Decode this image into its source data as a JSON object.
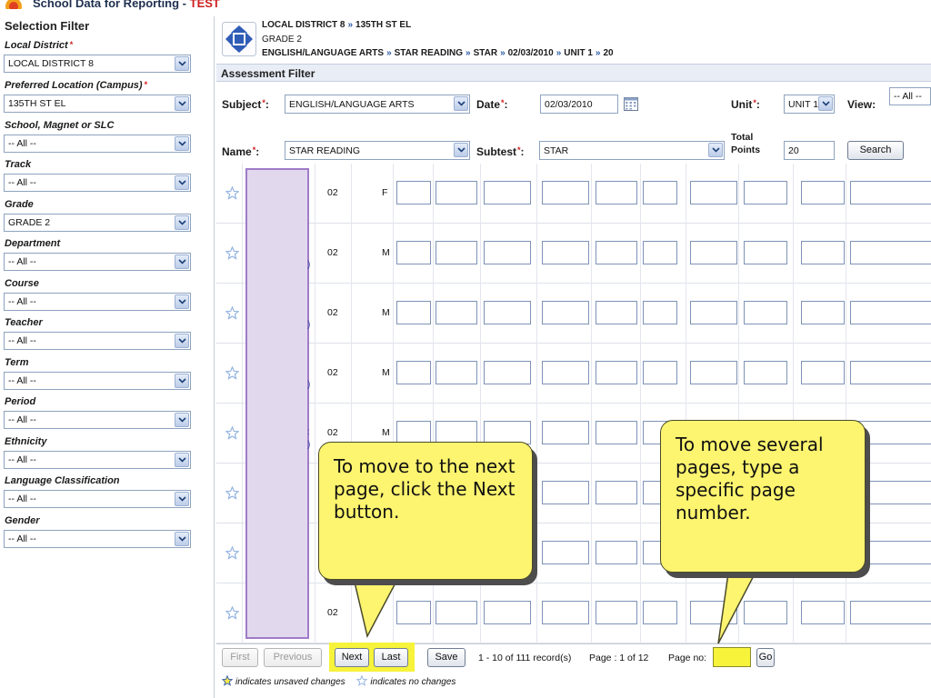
{
  "app": {
    "title": "School Data for Reporting - ",
    "title_suffix": "TEST"
  },
  "sidebar": {
    "title": "Selection Filter",
    "filters": [
      {
        "label": "Local District",
        "required": true,
        "value": "LOCAL DISTRICT 8"
      },
      {
        "label": "Preferred Location (Campus)",
        "required": true,
        "value": "135TH ST EL"
      },
      {
        "label": "School, Magnet or SLC",
        "required": false,
        "value": "-- All --"
      },
      {
        "label": "Track",
        "required": false,
        "value": "-- All --"
      },
      {
        "label": "Grade",
        "required": false,
        "value": "GRADE 2"
      },
      {
        "label": "Department",
        "required": false,
        "value": "-- All --"
      },
      {
        "label": "Course",
        "required": false,
        "value": "-- All --"
      },
      {
        "label": "Teacher",
        "required": false,
        "value": "-- All --"
      },
      {
        "label": "Term",
        "required": false,
        "value": "-- All --"
      },
      {
        "label": "Period",
        "required": false,
        "value": "-- All --"
      },
      {
        "label": "Ethnicity",
        "required": false,
        "value": "-- All --"
      },
      {
        "label": "Language Classification",
        "required": false,
        "value": "-- All --"
      },
      {
        "label": "Gender",
        "required": false,
        "value": "-- All --"
      }
    ],
    "required_mark": "*"
  },
  "breadcrumb": {
    "line1": [
      "LOCAL DISTRICT 8",
      "135TH ST EL"
    ],
    "line2": "GRADE 2",
    "line3": [
      "ENGLISH/LANGUAGE ARTS",
      "STAR READING",
      "STAR",
      "02/03/2010",
      "UNIT 1",
      "20"
    ],
    "separator": "»"
  },
  "assessment_filter": {
    "title": "Assessment Filter",
    "subject_label": "Subject",
    "subject_value": "ENGLISH/LANGUAGE ARTS",
    "date_label": "Date",
    "date_value": "02/03/2010",
    "unit_label": "Unit",
    "unit_value": "UNIT 1",
    "view_label": "View:",
    "view_value": "-- All --",
    "name_label": "Name",
    "name_value": "STAR READING",
    "subtest_label": "Subtest",
    "subtest_value": "STAR",
    "total_points_label_1": "Total",
    "total_points_label_2": "Points",
    "total_points_value": "20",
    "search_label": "Search",
    "label_colon": ":"
  },
  "rows": [
    {
      "grade": "02",
      "gender": "F"
    },
    {
      "grade": "02",
      "gender": "M"
    },
    {
      "grade": "02",
      "gender": "M"
    },
    {
      "grade": "02",
      "gender": "M"
    },
    {
      "grade": "02",
      "gender": "M"
    },
    {
      "grade": "",
      "gender": ""
    },
    {
      "grade": "",
      "gender": ""
    },
    {
      "grade": "02",
      "gender": ""
    }
  ],
  "name_fragments": [
    ")",
    ")",
    ")",
    ":",
    ")"
  ],
  "pager": {
    "first": "First",
    "previous": "Previous",
    "next": "Next",
    "last": "Last",
    "save": "Save",
    "records": "1 - 10 of 111 record(s)",
    "page": "Page : 1 of 12",
    "page_no_label": "Page no:",
    "go": "Go"
  },
  "legend": {
    "unsaved": "indicates unsaved changes",
    "nochange": "indicates no changes"
  },
  "callouts": {
    "next": "To move to the next page, click the Next button.",
    "page": "To move several pages,  type a specific page number."
  },
  "colors": {
    "highlight": "#f6f33a",
    "callout": "#fdf46f",
    "name_column": "#e2d8ee",
    "link_blue": "#2a5aa0",
    "required_red": "#d02020"
  },
  "icons": [
    "navigation-arrows-icon",
    "calendar-icon",
    "star-icon",
    "dropdown-arrow-icon",
    "logo-icon"
  ]
}
